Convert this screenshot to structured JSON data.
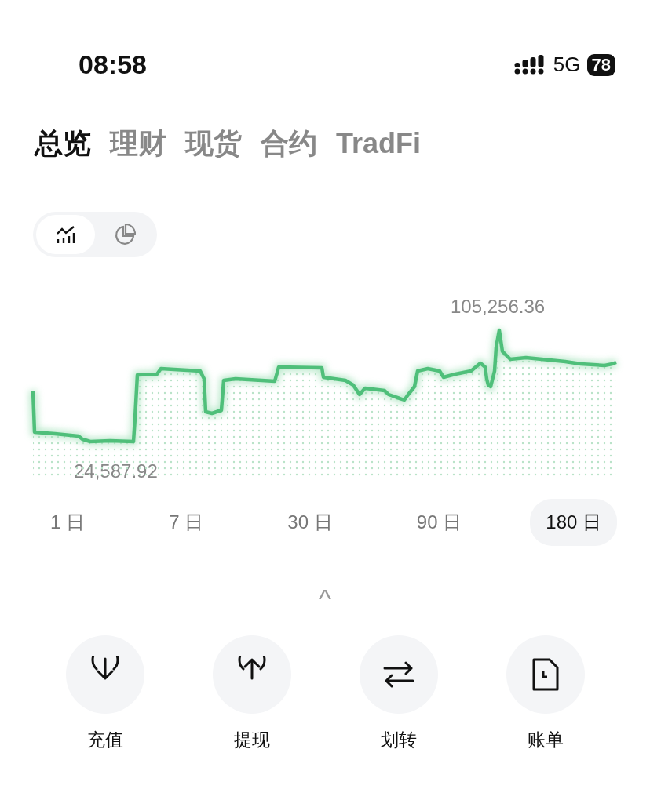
{
  "status_bar": {
    "time": "08:58",
    "network": "5G",
    "battery": "78"
  },
  "tabs": [
    {
      "label": "总览",
      "selected": true
    },
    {
      "label": "理财",
      "selected": false
    },
    {
      "label": "现货",
      "selected": false
    },
    {
      "label": "合约",
      "selected": false
    },
    {
      "label": "TradFi",
      "selected": false
    }
  ],
  "view_toggle": [
    {
      "selected": true
    },
    {
      "selected": false
    }
  ],
  "chart": {
    "max_label": "105,256.36",
    "min_label": "24,587.92"
  },
  "ranges": [
    {
      "label": "1 日",
      "selected": false
    },
    {
      "label": "7 日",
      "selected": false
    },
    {
      "label": "30 日",
      "selected": false
    },
    {
      "label": "90 日",
      "selected": false
    },
    {
      "label": "180 日",
      "selected": true
    }
  ],
  "collapse": "^",
  "actions": [
    {
      "label": "充值"
    },
    {
      "label": "提现"
    },
    {
      "label": "划转"
    },
    {
      "label": "账单"
    }
  ]
}
